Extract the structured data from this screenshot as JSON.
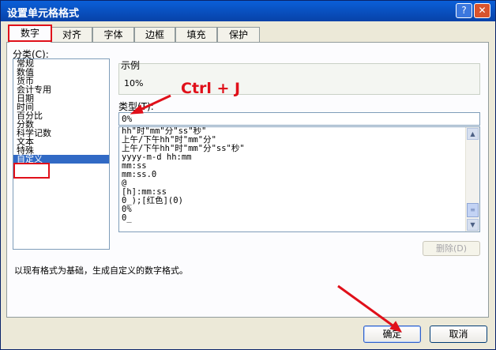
{
  "window": {
    "title": "设置单元格格式",
    "help_label": "?",
    "close_label": "✕"
  },
  "tabs": [
    {
      "label": "数字",
      "active": true
    },
    {
      "label": "对齐"
    },
    {
      "label": "字体"
    },
    {
      "label": "边框"
    },
    {
      "label": "填充"
    },
    {
      "label": "保护"
    }
  ],
  "category": {
    "label": "分类(C):",
    "items": [
      "常规",
      "数值",
      "货币",
      "会计专用",
      "日期",
      "时间",
      "百分比",
      "分数",
      "科学记数",
      "文本",
      "特殊",
      "自定义"
    ],
    "selected": "自定义"
  },
  "sample": {
    "label": "示例",
    "value": "10%"
  },
  "type": {
    "label": "类型(T):",
    "value": "0%",
    "formats": [
      "hh\"时\"mm\"分\"ss\"秒\"",
      "上午/下午hh\"时\"mm\"分\"",
      "上午/下午hh\"时\"mm\"分\"ss\"秒\"",
      "yyyy-m-d hh:mm",
      "mm:ss",
      "mm:ss.0",
      "@",
      "[h]:mm:ss",
      "0_);[红色](0)",
      "0%",
      "0_"
    ]
  },
  "delete_label": "删除(D)",
  "description": "以现有格式为基础，生成自定义的数字格式。",
  "ok_label": "确定",
  "cancel_label": "取消",
  "annotation": {
    "text": "Ctrl + J",
    "color": "#e0101a"
  }
}
